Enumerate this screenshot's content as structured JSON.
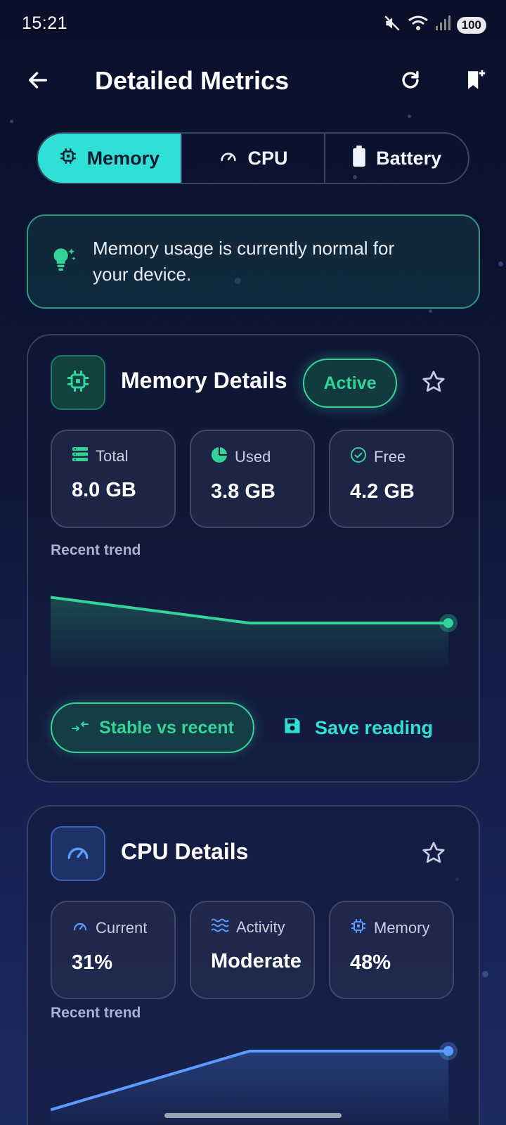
{
  "status_bar": {
    "time": "15:21",
    "battery": "100"
  },
  "app_bar": {
    "title": "Detailed Metrics"
  },
  "tabs": [
    {
      "label": "Memory",
      "icon": "chip-icon",
      "active": true
    },
    {
      "label": "CPU",
      "icon": "speedometer-icon",
      "active": false
    },
    {
      "label": "Battery",
      "icon": "battery-icon",
      "active": false
    }
  ],
  "info_banner": {
    "text": "Memory usage is currently normal for your device."
  },
  "memory_card": {
    "title": "Memory Details",
    "badge": "Active",
    "stats": [
      {
        "icon": "storage-icon",
        "label": "Total",
        "value": "8.0 GB"
      },
      {
        "icon": "pie-icon",
        "label": "Used",
        "value": "3.8 GB"
      },
      {
        "icon": "check-circle-icon",
        "label": "Free",
        "value": "4.2 GB"
      }
    ],
    "trend_label": "Recent trend",
    "trend": {
      "values": [
        52,
        47.5,
        47.5
      ],
      "range": [
        40,
        56
      ]
    },
    "stable_button": "Stable vs recent",
    "save_button": "Save reading"
  },
  "cpu_card": {
    "title": "CPU Details",
    "stats": [
      {
        "icon": "speedometer-icon",
        "label": "Current",
        "value": "31%"
      },
      {
        "icon": "waves-icon",
        "label": "Activity",
        "value": "Moderate"
      },
      {
        "icon": "chip-icon",
        "label": "Memory",
        "value": "48%"
      }
    ],
    "trend_label": "Recent trend",
    "trend": {
      "values": [
        22,
        31,
        31
      ],
      "range": [
        20,
        34
      ]
    }
  },
  "colors": {
    "accent_teal": "#2ee0d5",
    "accent_green": "#34d399",
    "accent_blue": "#5b9bff"
  }
}
